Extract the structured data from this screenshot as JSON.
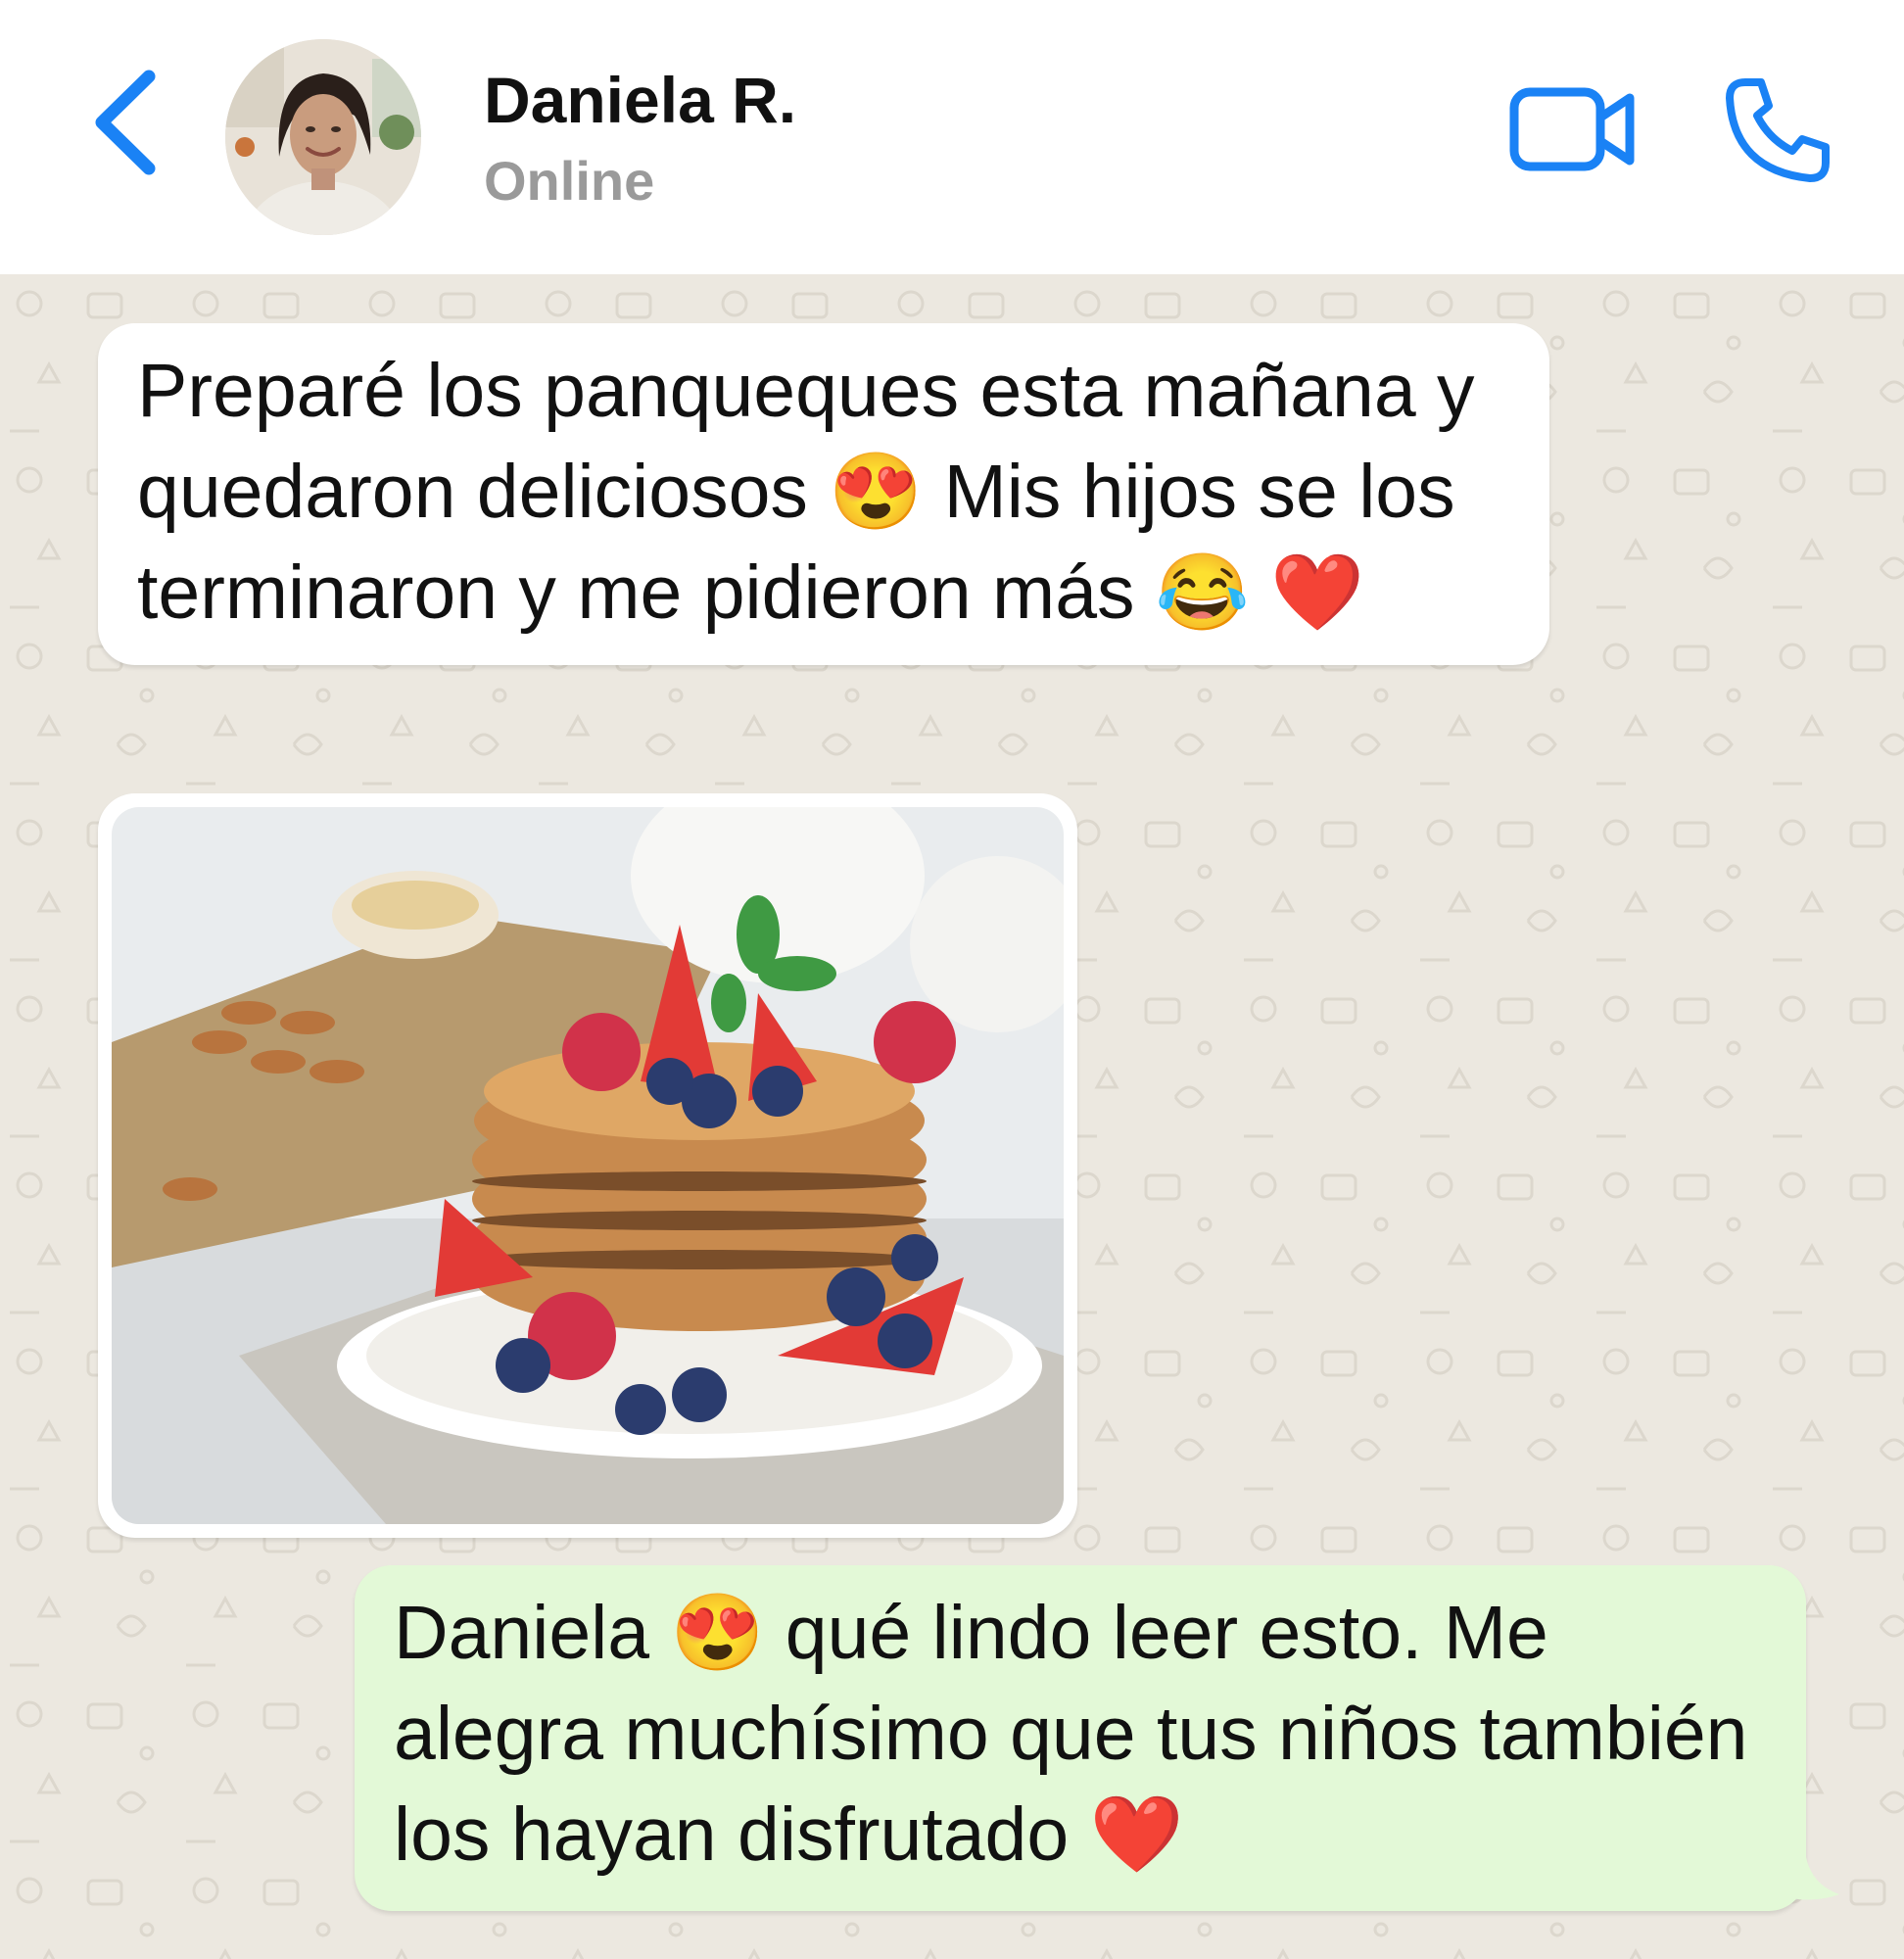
{
  "header": {
    "contact_name": "Daniela R.",
    "status": "Online",
    "accent_color": "#1A82F5",
    "icons": [
      "chevron-left-icon",
      "video-camera-icon",
      "phone-icon"
    ]
  },
  "messages": [
    {
      "direction": "incoming",
      "text": "Preparé los panqueques esta mañana y quedaron deliciosos 😍 Mis hijos se los terminaron y me pidieron más 😂 ❤️"
    },
    {
      "direction": "incoming",
      "type": "image",
      "image": "pancake-stack-with-berries-photo"
    },
    {
      "direction": "outgoing",
      "text": "Daniela 😍 qué lindo leer esto. Me alegra muchísimo que tus niños también los hayan disfrutado ❤️"
    }
  ],
  "colors": {
    "incoming_bubble": "#FFFFFF",
    "outgoing_bubble": "#E3F9D7",
    "chat_background": "#ECE8E0"
  }
}
